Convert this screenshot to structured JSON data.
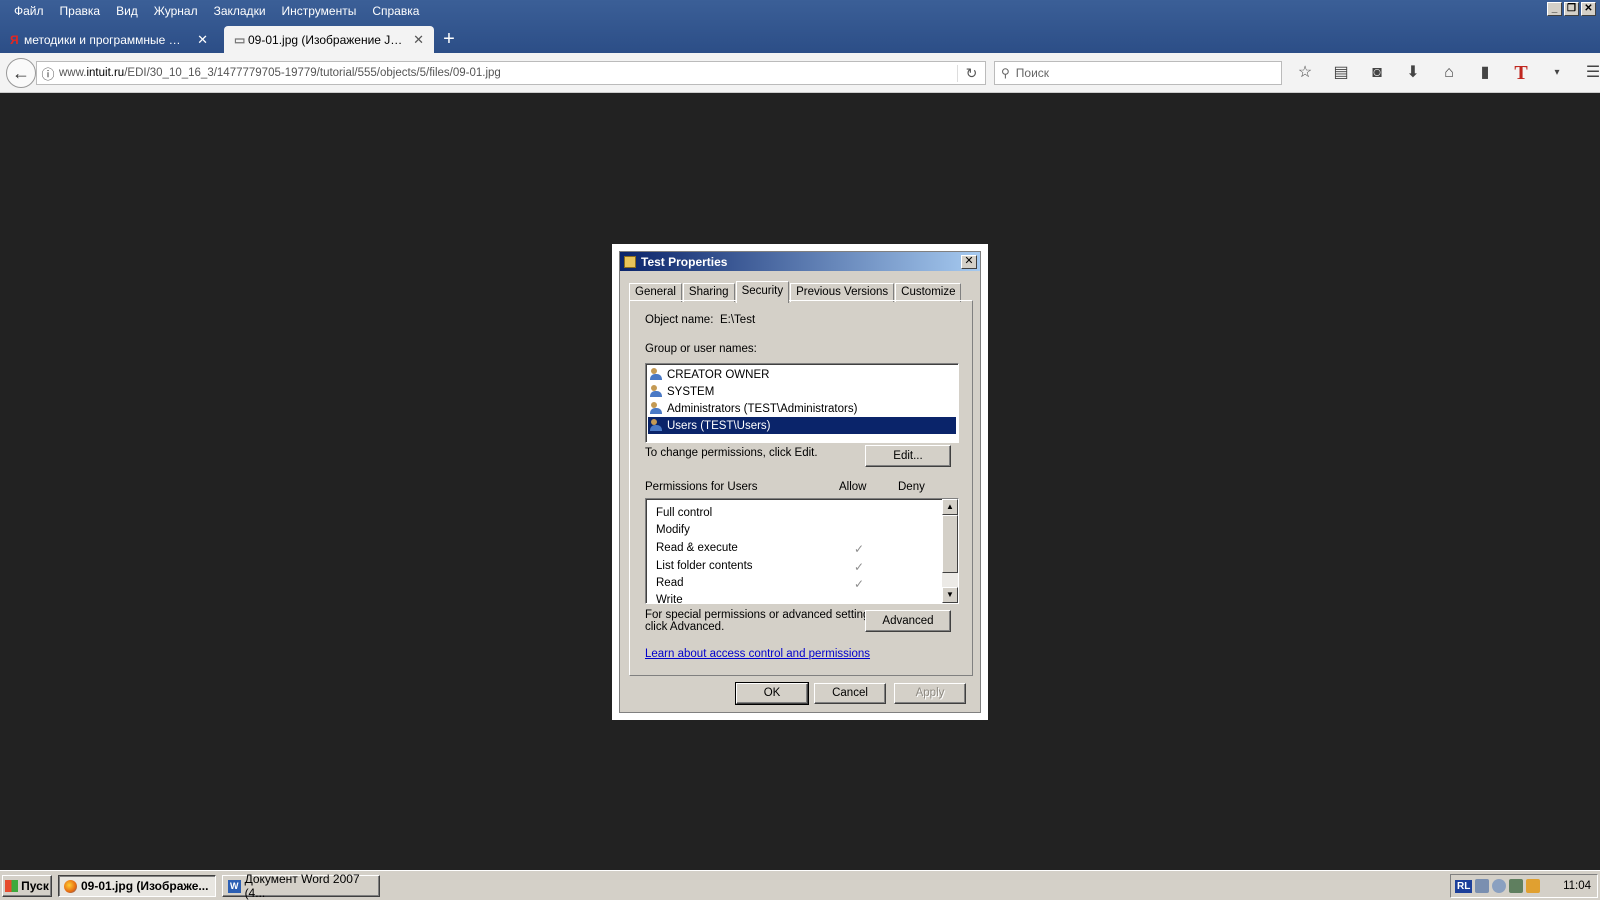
{
  "browser": {
    "menu": [
      "Файл",
      "Правка",
      "Вид",
      "Журнал",
      "Закладки",
      "Инструменты",
      "Справка"
    ],
    "tabs": [
      {
        "label": "методики и программные пр...",
        "icon": "Я"
      },
      {
        "label": "09-01.jpg (Изображение JPE...",
        "icon": "▭"
      }
    ],
    "url_prefix": "www.",
    "url_domain": "intuit.ru",
    "url_path": "/EDI/30_10_16_3/1477779705-19779/tutorial/555/objects/5/files/09-01.jpg",
    "search_placeholder": "Поиск",
    "window_buttons": [
      "_",
      "❐",
      "✕"
    ]
  },
  "dialog": {
    "title": "Test Properties",
    "close": "✕",
    "tabs": [
      "General",
      "Sharing",
      "Security",
      "Previous Versions",
      "Customize"
    ],
    "object_name_label": "Object name:",
    "object_name_value": "E:\\Test",
    "group_label": "Group or user names:",
    "users": [
      "CREATOR OWNER",
      "SYSTEM",
      "Administrators (TEST\\Administrators)",
      "Users (TEST\\Users)"
    ],
    "change_text": "To change permissions, click Edit.",
    "edit_button": "Edit...",
    "permissions_label": "Permissions for Users",
    "allow_label": "Allow",
    "deny_label": "Deny",
    "permissions": [
      {
        "name": "Full control",
        "allow": ""
      },
      {
        "name": "Modify",
        "allow": ""
      },
      {
        "name": "Read & execute",
        "allow": "✓"
      },
      {
        "name": "List folder contents",
        "allow": "✓"
      },
      {
        "name": "Read",
        "allow": "✓"
      },
      {
        "name": "Write",
        "allow": ""
      }
    ],
    "special_text_1": "For special permissions or advanced settings,",
    "special_text_2": "click Advanced.",
    "advanced_button": "Advanced",
    "learn_link": "Learn about access control and permissions",
    "ok_button": "OK",
    "cancel_button": "Cancel",
    "apply_button": "Apply"
  },
  "taskbar": {
    "start": "Пуск",
    "tasks": [
      "09-01.jpg (Изображе...",
      "Документ Word 2007 (4..."
    ],
    "lang": "RL",
    "clock": "11:04"
  }
}
